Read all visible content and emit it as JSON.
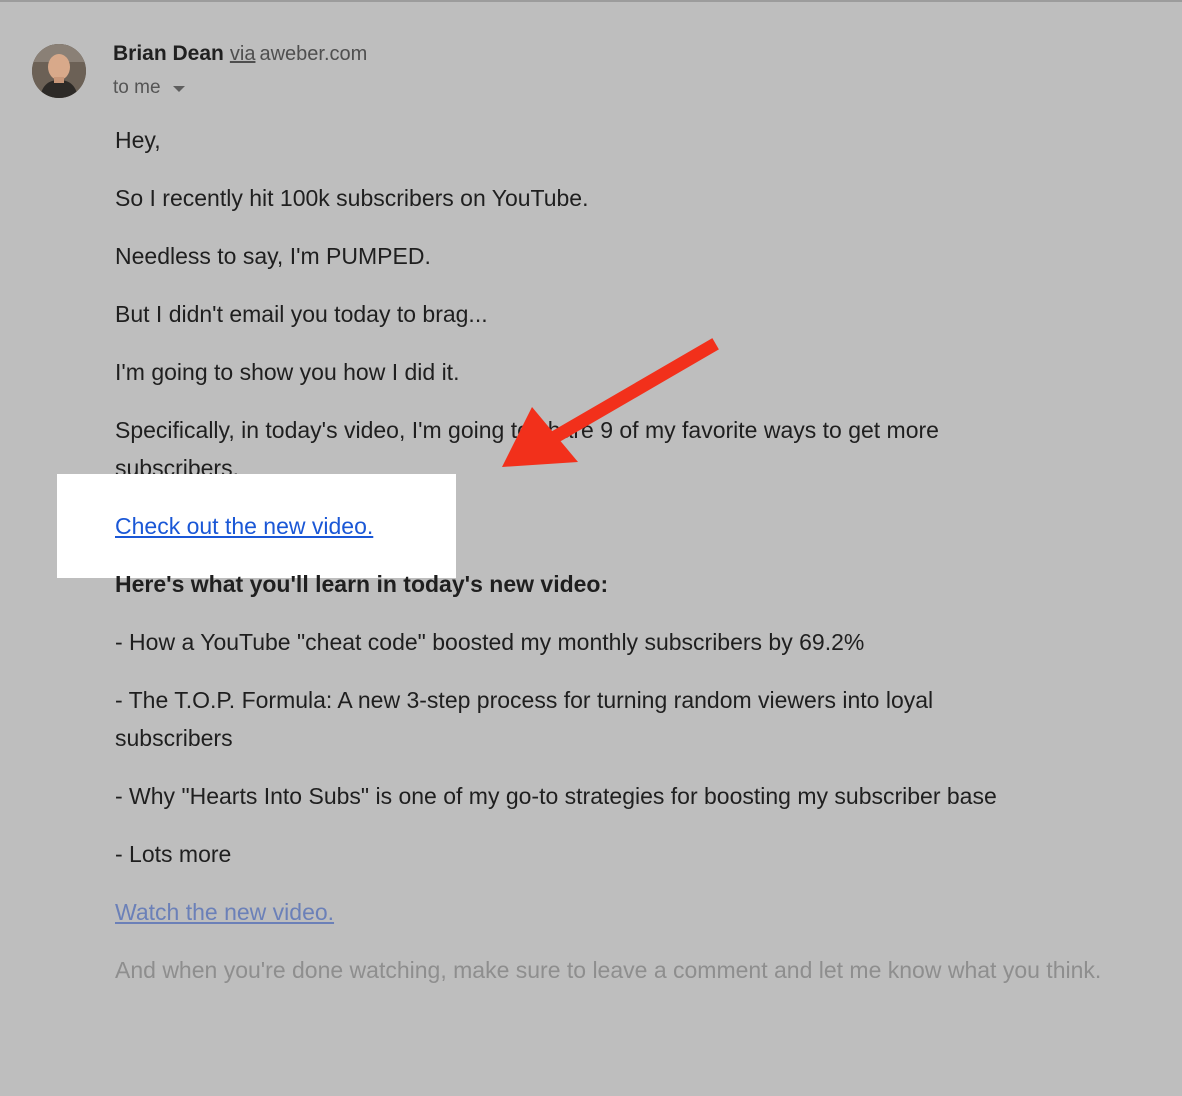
{
  "sender": {
    "name": "Brian Dean",
    "via_label": "via",
    "domain": "aweber.com"
  },
  "recipient": {
    "label": "to me"
  },
  "body": {
    "greeting": "Hey,",
    "line1": "So I recently hit 100k subscribers on YouTube.",
    "line2": "Needless to say, I'm PUMPED.",
    "line3": "But I didn't email you today to brag...",
    "line4": "I'm going to show you how I did it.",
    "line5": "Specifically, in today's video, I'm going to share 9 of my favorite ways to get more subscribers.",
    "link1": "Check out the new video.",
    "heading": "Here's what you'll learn in today's new video:",
    "bullet1": "- How a YouTube \"cheat code\" boosted my monthly subscribers by 69.2%",
    "bullet2": "- The T.O.P. Formula: A new 3-step process for turning random viewers into loyal subscribers",
    "bullet3": "- Why \"Hearts Into Subs\" is one of my go-to strategies for boosting my subscriber base",
    "bullet4": "- Lots more",
    "link2": "Watch the new video.",
    "closing": "And when you're done watching, make sure to leave a comment and let me know what you think."
  },
  "colors": {
    "background": "#bebebe",
    "highlight": "#ffffff",
    "link": "#1a57d6",
    "arrow": "#f2301b"
  },
  "icons": {
    "avatar": "avatar",
    "recipient_toggle": "caret-down-icon",
    "annotation": "arrow-annotation"
  }
}
